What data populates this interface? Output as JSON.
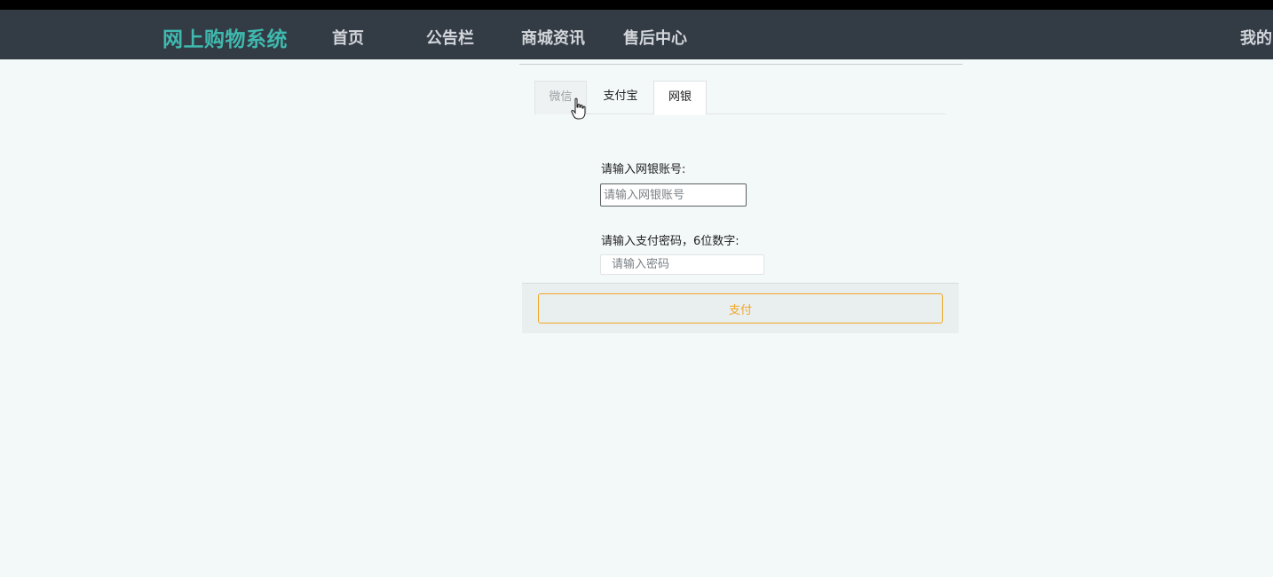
{
  "nav": {
    "brand": "网上购物系统",
    "items": [
      "首页",
      "公告栏",
      "商城资讯",
      "售后中心"
    ],
    "mine": "我的"
  },
  "payment": {
    "tabs": [
      "微信",
      "支付宝",
      "网银"
    ],
    "active_tab": "网银",
    "account_label": "请输入网银账号:",
    "account_placeholder": "请输入网银账号",
    "password_label": "请输入支付密码，6位数字:",
    "password_placeholder": "请输入密码",
    "pay_button": "支付"
  },
  "colors": {
    "brand": "#3fb9ae",
    "navbar": "#333b45",
    "accent": "#f2a623",
    "background": "#f3f8f8"
  }
}
